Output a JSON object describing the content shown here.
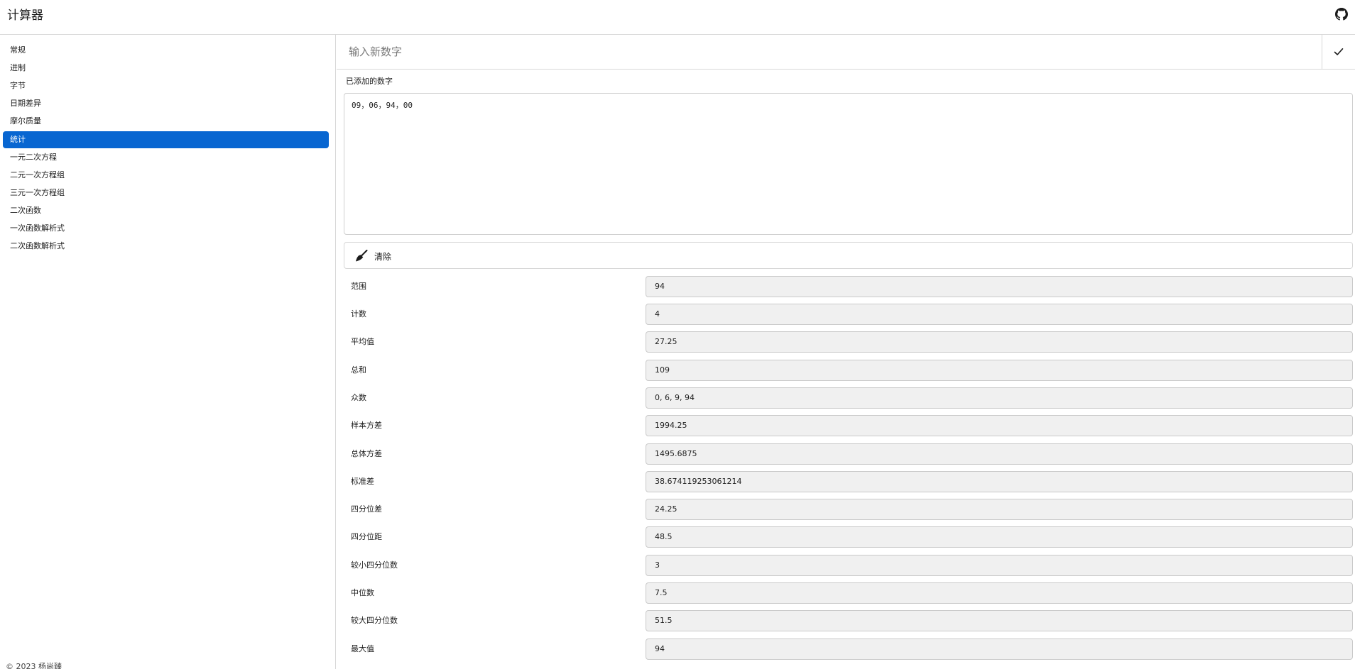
{
  "app": {
    "title": "计算器"
  },
  "sidebar": {
    "items": [
      {
        "label": "常规",
        "active": false
      },
      {
        "label": "进制",
        "active": false
      },
      {
        "label": "字节",
        "active": false
      },
      {
        "label": "日期差异",
        "active": false
      },
      {
        "label": "摩尔质量",
        "active": false
      },
      {
        "label": "统计",
        "active": true
      },
      {
        "label": "一元二次方程",
        "active": false
      },
      {
        "label": "二元一次方程组",
        "active": false
      },
      {
        "label": "三元一次方程组",
        "active": false
      },
      {
        "label": "二次函数",
        "active": false
      },
      {
        "label": "一次函数解析式",
        "active": false
      },
      {
        "label": "二次函数解析式",
        "active": false
      }
    ],
    "footer": "© 2023 杨尚臻"
  },
  "main": {
    "input_placeholder": "输入新数字",
    "input_value": "",
    "added_label": "已添加的数字",
    "numbers_text": "09，06，94，00",
    "clear_label": "清除",
    "stats": [
      {
        "label": "范围",
        "value": "94"
      },
      {
        "label": "计数",
        "value": "4"
      },
      {
        "label": "平均值",
        "value": "27.25"
      },
      {
        "label": "总和",
        "value": "109"
      },
      {
        "label": "众数",
        "value": "0, 6, 9, 94"
      },
      {
        "label": "样本方差",
        "value": "1994.25"
      },
      {
        "label": "总体方差",
        "value": "1495.6875"
      },
      {
        "label": "标准差",
        "value": "38.674119253061214"
      },
      {
        "label": "四分位差",
        "value": "24.25"
      },
      {
        "label": "四分位距",
        "value": "48.5"
      },
      {
        "label": "较小四分位数",
        "value": "3"
      },
      {
        "label": "中位数",
        "value": "7.5"
      },
      {
        "label": "较大四分位数",
        "value": "51.5"
      },
      {
        "label": "最大值",
        "value": "94"
      }
    ]
  },
  "colors": {
    "accent": "#0866d1",
    "readonly_bg": "#f0f0f0",
    "border": "#d7d7d7"
  },
  "icons": {
    "repo": "github-icon",
    "confirm": "check-icon",
    "clear": "broom-icon"
  }
}
